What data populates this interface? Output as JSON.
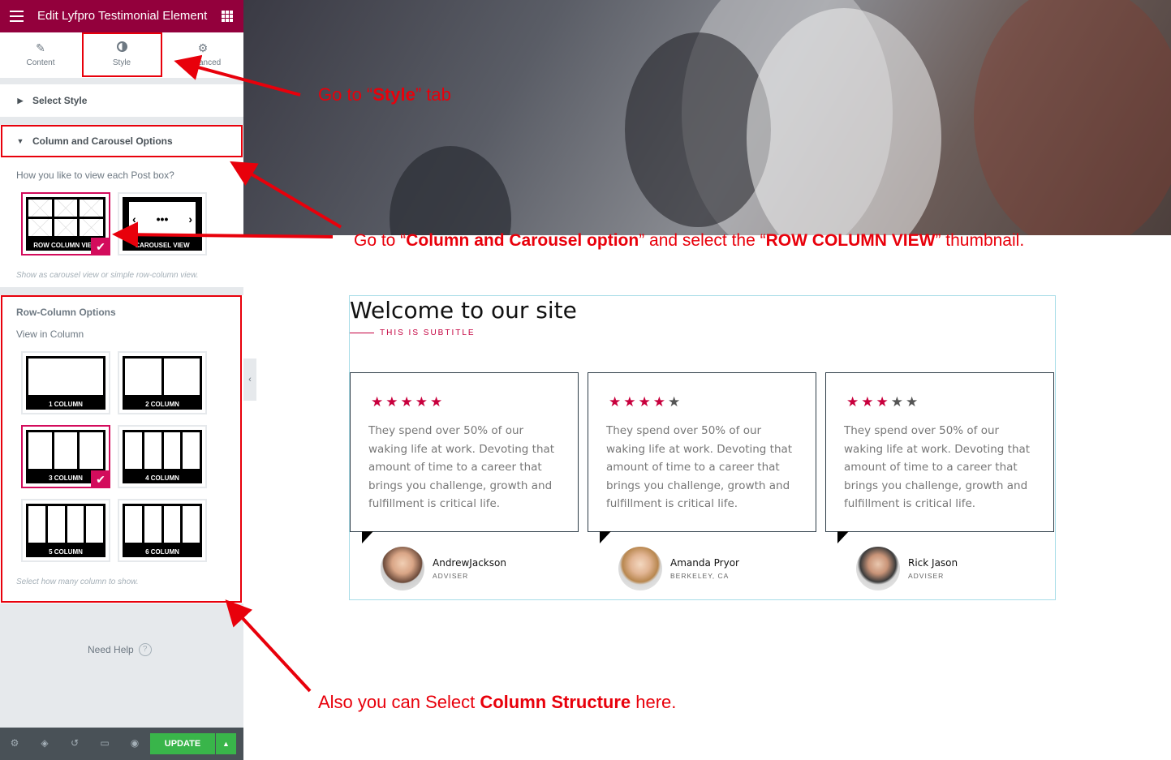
{
  "topbar": {
    "title": "Edit Lyfpro Testimonial Element"
  },
  "tabs": [
    {
      "label": "Content",
      "icon": "pencil-icon"
    },
    {
      "label": "Style",
      "icon": "contrast-icon"
    },
    {
      "label": "Advanced",
      "icon": "gear-icon"
    }
  ],
  "sections": {
    "select_style": "Select Style",
    "column_carousel": "Column and Carousel Options"
  },
  "view_option": {
    "question": "How you like to view each Post box?",
    "thumbs": [
      "ROW COLUMN VIEW",
      "CAROUSEL VIEW"
    ],
    "selected": "ROW COLUMN VIEW",
    "description": "Show as carousel view or simple row-column view."
  },
  "row_column": {
    "heading": "Row-Column Options",
    "label": "View in Column",
    "thumbs": [
      "1 COLUMN",
      "2 COLUMN",
      "3 COLUMN",
      "4 COLUMN",
      "5 COLUMN",
      "6 COLUMN"
    ],
    "selected": "3 COLUMN",
    "description": "Select how many column to show."
  },
  "help": {
    "label": "Need Help"
  },
  "footer": {
    "update_label": "UPDATE"
  },
  "site": {
    "title": "Welcome to our site",
    "subtitle": "THIS IS SUBTITLE",
    "testimonial_text": "They spend over 50% of our waking life at work. Devoting that amount of time to a career that brings you challenge, growth and fulfillment is critical life.",
    "cards": [
      {
        "stars": 5,
        "name": "AndrewJackson",
        "role": "ADVISER"
      },
      {
        "stars": 4,
        "name": "Amanda Pryor",
        "role": "BERKELEY, CA"
      },
      {
        "stars": 3,
        "name": "Rick Jason",
        "role": "ADVISER"
      }
    ]
  },
  "annotations": {
    "style_tab": {
      "pre": "Go  to “",
      "bold": "Style",
      "post": "” tab"
    },
    "column_option": {
      "pre": "Go to “",
      "bold1": "Column and Carousel option",
      "mid": "” and select the “",
      "bold2": "ROW COLUMN VIEW",
      "post": "” thumbnail."
    },
    "column_structure": {
      "pre": "Also you can Select ",
      "bold": "Column Structure",
      "post": " here."
    }
  },
  "colors": {
    "brand": "#93003c",
    "accent": "#d30c5c",
    "annotation": "#e8000b",
    "update": "#39b54a",
    "star": "#c8003d"
  }
}
